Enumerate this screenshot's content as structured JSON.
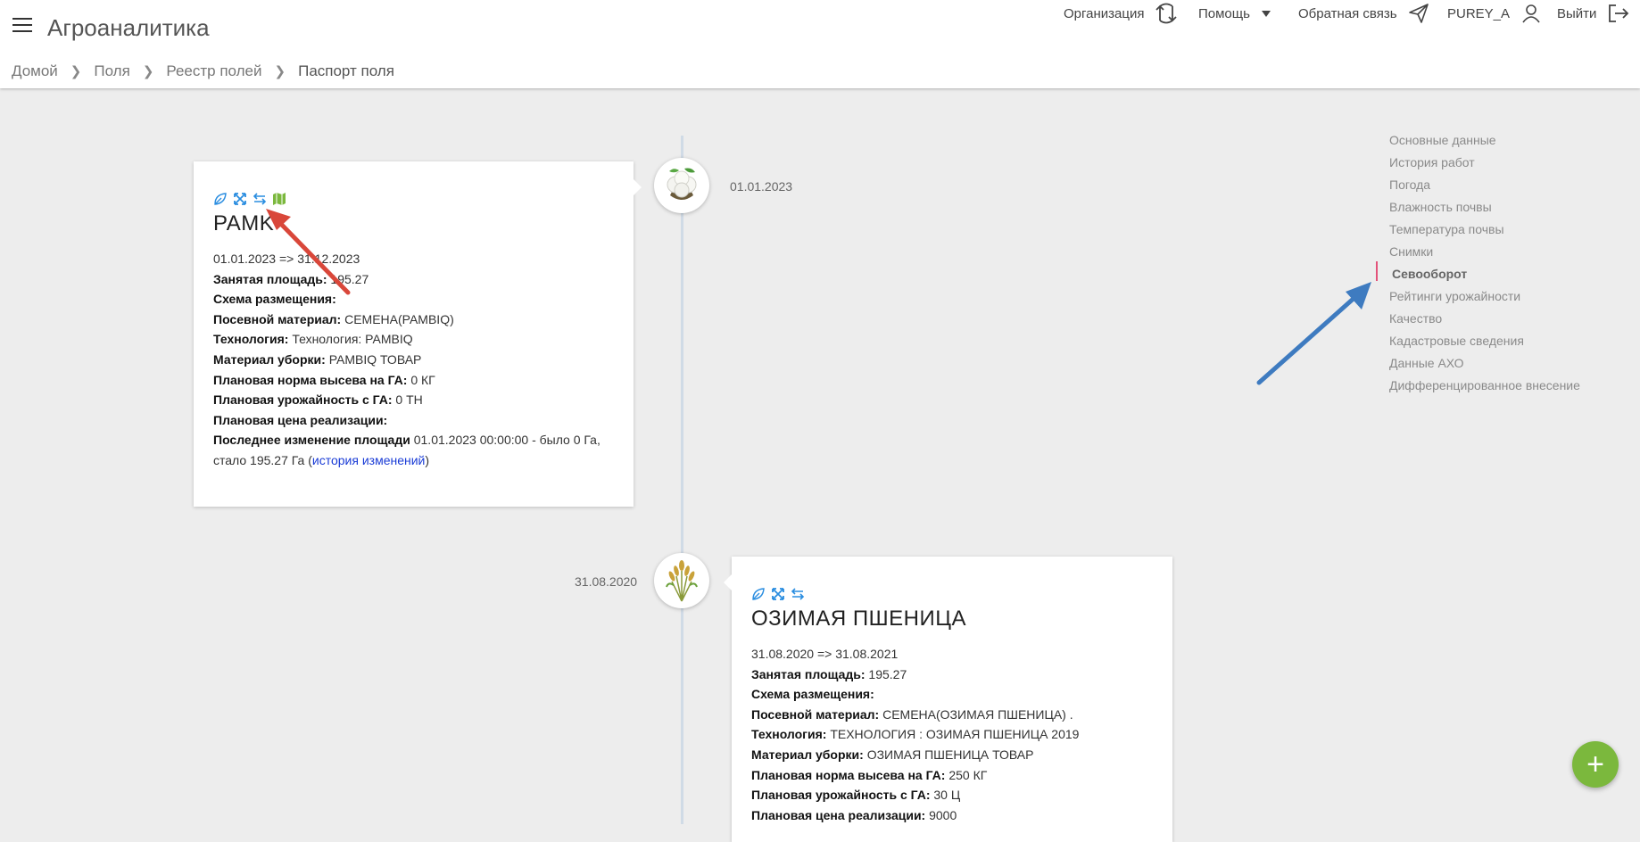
{
  "header": {
    "app_title": "Агроаналитика",
    "org_label": "Организация",
    "help_label": "Помощь",
    "feedback_label": "Обратная связь",
    "user_label": "PUREY_A",
    "logout_label": "Выйти"
  },
  "breadcrumbs": [
    "Домой",
    "Поля",
    "Реестр полей",
    "Паспорт поля"
  ],
  "timeline": [
    {
      "date": "01.01.2023",
      "crop_icon": "cotton-icon",
      "title": "PAMK",
      "period": "01.01.2023 => 31.12.2023",
      "occupied_area_label": "Занятая площадь:",
      "occupied_area": "195.27",
      "layout_scheme_label": "Схема размещения:",
      "layout_scheme": "",
      "seed_label": "Посевной материал:",
      "seed": "СЕМЕНА(PAMBIQ)",
      "technology_label": "Технология:",
      "technology": "Технология: PAMBIQ",
      "harvest_label": "Материал уборки:",
      "harvest": "PAMBIQ ТОВАР",
      "seeding_rate_label": "Плановая норма высева на ГА:",
      "seeding_rate": "0 КГ",
      "yield_label": "Плановая урожайность с ГА:",
      "yield": "0 ТН",
      "price_label": "Плановая цена реализации:",
      "price": "",
      "last_change_label": "Последнее изменение площади",
      "last_change": "01.01.2023 00:00:00 - было 0 Га,",
      "last_change_2": "стало 195.27 Га (",
      "history_link": "история изменений",
      "last_change_end": ")"
    },
    {
      "date": "31.08.2020",
      "crop_icon": "wheat-icon",
      "title": "ОЗИМАЯ ПШЕНИЦА",
      "period": "31.08.2020 => 31.08.2021",
      "occupied_area_label": "Занятая площадь:",
      "occupied_area": "195.27",
      "layout_scheme_label": "Схема размещения:",
      "layout_scheme": "",
      "seed_label": "Посевной материал:",
      "seed": "СЕМЕНА(ОЗИМАЯ ПШЕНИЦА) .",
      "technology_label": "Технология:",
      "technology": "ТЕХНОЛОГИЯ : ОЗИМАЯ ПШЕНИЦА 2019",
      "harvest_label": "Материал уборки:",
      "harvest": "ОЗИМАЯ ПШЕНИЦА ТОВАР",
      "seeding_rate_label": "Плановая норма высева на ГА:",
      "seeding_rate": "250 КГ",
      "yield_label": "Плановая урожайность с ГА:",
      "yield": "30 Ц",
      "price_label": "Плановая цена реализации:",
      "price": "9000"
    }
  ],
  "side_nav": {
    "items": [
      "Основные данные",
      "История работ",
      "Погода",
      "Влажность почвы",
      "Температура почвы",
      "Снимки",
      "Севооборот",
      "Рейтинги урожайности",
      "Качество",
      "Кадастровые сведения",
      "Данные АХО",
      "Дифференцированное внесение"
    ],
    "active": "Севооборот"
  },
  "fab_label": "+",
  "colors": {
    "accent_green": "#7bb83d",
    "icon_blue": "#2a8de0",
    "link_blue": "#1a3cd6",
    "arrow_red": "#d9473a",
    "arrow_blue": "#3e7bc0",
    "active_marker": "#e3527a"
  }
}
